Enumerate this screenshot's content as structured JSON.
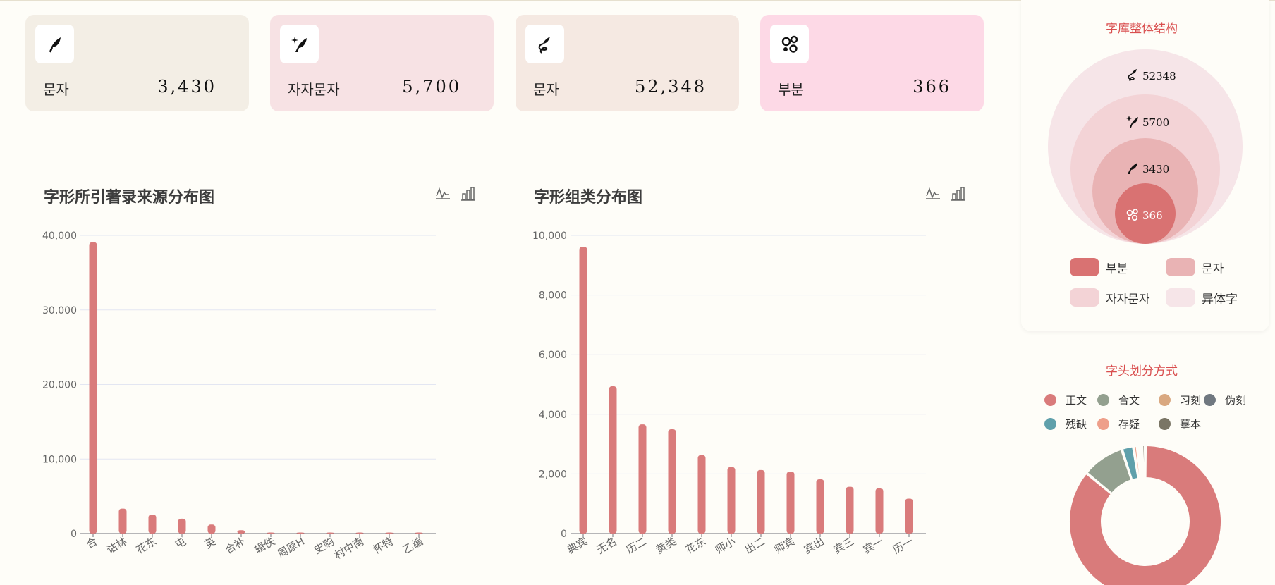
{
  "cards": [
    {
      "label": "문자",
      "value": "3,430",
      "bg": "#f3eee5",
      "icon": "quill-icon"
    },
    {
      "label": "자자문자",
      "value": "5,700",
      "bg": "#f7e2e4",
      "icon": "quill-sparkle-icon"
    },
    {
      "label": "문자",
      "value": "52,348",
      "bg": "#f5e9e2",
      "icon": "feather-swirl-icon"
    },
    {
      "label": "부분",
      "value": "366",
      "bg": "#fdd9e6",
      "icon": "components-icon"
    }
  ],
  "bar_color": "#d97b7b",
  "chart_data": [
    {
      "type": "bar",
      "title": "字形所引著录来源分布图",
      "categories": [
        "合",
        "诂林",
        "花东",
        "屯",
        "英",
        "合补",
        "辑佚",
        "周原H",
        "史购",
        "村中南",
        "怀特",
        "乙编"
      ],
      "values": [
        39100,
        3350,
        2550,
        2000,
        1200,
        450,
        120,
        80,
        60,
        50,
        30,
        20
      ],
      "ylim": [
        0,
        40000
      ],
      "yticks": [
        "0",
        "10,000",
        "20,000",
        "30,000",
        "40,000"
      ],
      "grid": true
    },
    {
      "type": "bar",
      "title": "字形组类分布图",
      "categories": [
        "典宾",
        "无名",
        "历二",
        "黄类",
        "花东",
        "师小",
        "出二",
        "师宾",
        "宾出",
        "宾三",
        "宾一",
        "历一"
      ],
      "values": [
        9620,
        4940,
        3660,
        3500,
        2630,
        2230,
        2130,
        2080,
        1820,
        1570,
        1520,
        1170
      ],
      "ylim": [
        0,
        10000
      ],
      "yticks": [
        "0",
        "2,000",
        "4,000",
        "6,000",
        "8,000",
        "10,000"
      ],
      "grid": true
    },
    {
      "type": "bubble",
      "title": "字库整体结构",
      "circles": [
        {
          "value": 52348,
          "label": "52348",
          "color": "#f6e5e8",
          "icon": "feather-swirl-icon"
        },
        {
          "value": 5700,
          "label": "5700",
          "color": "#f3d3d6",
          "icon": "quill-sparkle-icon"
        },
        {
          "value": 3430,
          "label": "3430",
          "color": "#e9b3b4",
          "icon": "quill-icon"
        },
        {
          "value": 366,
          "label": "366",
          "color": "#d97272",
          "icon": "components-icon"
        }
      ],
      "legend": [
        {
          "name": "부분",
          "color": "#d97272"
        },
        {
          "name": "문자",
          "color": "#e9b3b4"
        },
        {
          "name": "자자문자",
          "color": "#f3d3d6"
        },
        {
          "name": "异体字",
          "color": "#f6e5e8"
        }
      ]
    },
    {
      "type": "pie",
      "title": "字头划分方式",
      "legend": [
        {
          "name": "正文",
          "color": "#d97b7b"
        },
        {
          "name": "合文",
          "color": "#93a08f"
        },
        {
          "name": "习刻",
          "color": "#d9a880"
        },
        {
          "name": "伪刻",
          "color": "#707880"
        },
        {
          "name": "残缺",
          "color": "#5fa0ab"
        },
        {
          "name": "存疑",
          "color": "#ee9f8a"
        },
        {
          "name": "摹本",
          "color": "#7a7565"
        }
      ],
      "slices": [
        {
          "name": "正文",
          "value": 86.0
        },
        {
          "name": "合文",
          "value": 9.0
        },
        {
          "name": "残缺",
          "value": 2.5
        },
        {
          "name": "存疑",
          "value": 0.8
        },
        {
          "name": "习刻",
          "value": 0.5
        },
        {
          "name": "伪刻",
          "value": 0.5
        },
        {
          "name": "摹本",
          "value": 0.7
        }
      ]
    }
  ]
}
